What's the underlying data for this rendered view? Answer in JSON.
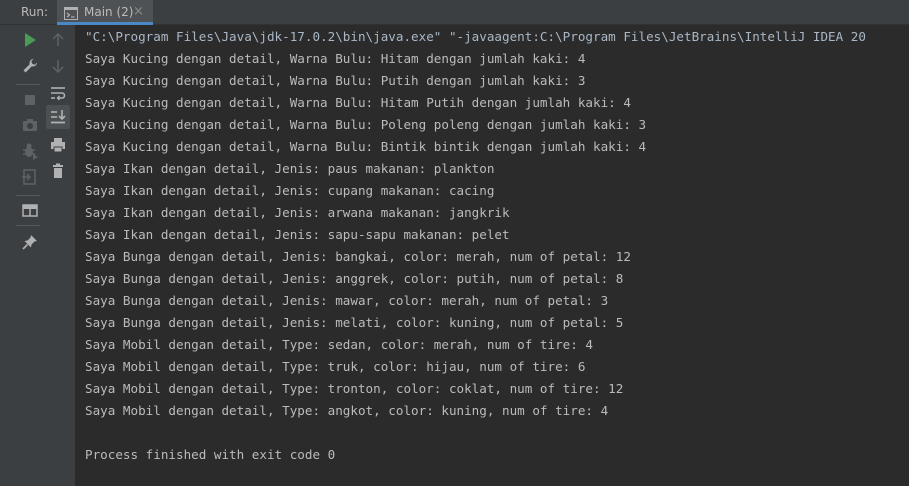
{
  "run_panel": {
    "label": "Run:",
    "tab": {
      "label": "Main (2)",
      "close": "×"
    }
  },
  "toolbar": {
    "icons": [
      "rerun-icon",
      "up-arrow-icon",
      "wrench-icon",
      "down-arrow-icon",
      "stop-icon",
      "soft-wrap-icon",
      "camera-icon",
      "scroll-to-end-icon",
      "debug-icon",
      "print-icon",
      "exit-icon",
      "delete-icon",
      "layout-icon",
      "pin-icon"
    ]
  },
  "console": {
    "command": "\"C:\\Program Files\\Java\\jdk-17.0.2\\bin\\java.exe\" \"-javaagent:C:\\Program Files\\JetBrains\\IntelliJ IDEA 20",
    "lines": [
      "Saya Kucing dengan detail, Warna Bulu: Hitam dengan jumlah kaki: 4",
      "Saya Kucing dengan detail, Warna Bulu: Putih dengan jumlah kaki: 3",
      "Saya Kucing dengan detail, Warna Bulu: Hitam Putih dengan jumlah kaki: 4",
      "Saya Kucing dengan detail, Warna Bulu: Poleng poleng dengan jumlah kaki: 3",
      "Saya Kucing dengan detail, Warna Bulu: Bintik bintik dengan jumlah kaki: 4",
      "Saya Ikan dengan detail, Jenis: paus makanan: plankton",
      "Saya Ikan dengan detail, Jenis: cupang makanan: cacing",
      "Saya Ikan dengan detail, Jenis: arwana makanan: jangkrik",
      "Saya Ikan dengan detail, Jenis: sapu-sapu makanan: pelet",
      "Saya Bunga dengan detail, Jenis: bangkai, color: merah, num of petal: 12",
      "Saya Bunga dengan detail, Jenis: anggrek, color: putih, num of petal: 8",
      "Saya Bunga dengan detail, Jenis: mawar, color: merah, num of petal: 3",
      "Saya Bunga dengan detail, Jenis: melati, color: kuning, num of petal: 5",
      "Saya Mobil dengan detail, Type: sedan, color: merah, num of tire: 4",
      "Saya Mobil dengan detail, Type: truk, color: hijau, num of tire: 6",
      "Saya Mobil dengan detail, Type: tronton, color: coklat, num of tire: 12",
      "Saya Mobil dengan detail, Type: angkot, color: kuning, num of tire: 4"
    ],
    "exit_message": "Process finished with exit code 0"
  },
  "colors": {
    "background": "#2b2b2b",
    "panel": "#3c3f41",
    "text": "#bbbbbb",
    "run_green": "#499c54",
    "tab_underline": "#4a88c7"
  }
}
